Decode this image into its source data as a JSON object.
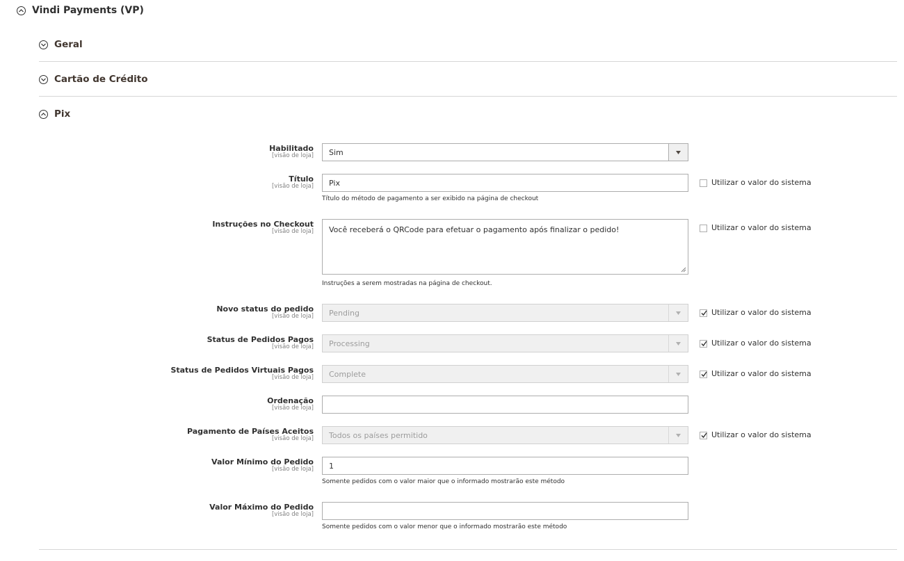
{
  "main_section": {
    "title": "Vindi Payments (VP)"
  },
  "groups": [
    {
      "title": "Geral"
    },
    {
      "title": "Cartão de Crédito"
    },
    {
      "title": "Pix"
    }
  ],
  "scope_label": "[visão de loja]",
  "use_system_label": "Utilizar o valor do sistema",
  "fields": {
    "habilitado": {
      "label": "Habilitado",
      "value": "Sim"
    },
    "titulo": {
      "label": "Título",
      "value": "Pix",
      "note": "Título do método de pagamento a ser exibido na página de checkout",
      "use_system": false
    },
    "instrucoes": {
      "label": "Instruções no Checkout",
      "value": "Você receberá o QRCode para efetuar o pagamento após finalizar o pedido!",
      "note": "Instruções a serem mostradas na página de checkout.",
      "use_system": false
    },
    "novo_status": {
      "label": "Novo status do pedido",
      "value": "Pending",
      "use_system": true
    },
    "status_pagos": {
      "label": "Status de Pedidos Pagos",
      "value": "Processing",
      "use_system": true
    },
    "status_virtuais": {
      "label": "Status de Pedidos Virtuais Pagos",
      "value": "Complete",
      "use_system": true
    },
    "ordenacao": {
      "label": "Ordenação",
      "value": ""
    },
    "paises": {
      "label": "Pagamento de Países Aceitos",
      "value": "Todos os países permitido",
      "use_system": true
    },
    "valor_minimo": {
      "label": "Valor Mínimo do Pedido",
      "value": "1",
      "note": "Somente pedidos com o valor maior que o informado mostrarão este método"
    },
    "valor_maximo": {
      "label": "Valor Máximo do Pedido",
      "value": "",
      "note": "Somente pedidos com o valor menor que o informado mostrarão este método"
    }
  },
  "colors": {
    "text": "#303030",
    "muted": "#808080",
    "divider": "#d6d6d6",
    "disabled_bg": "#f0f0f0"
  }
}
